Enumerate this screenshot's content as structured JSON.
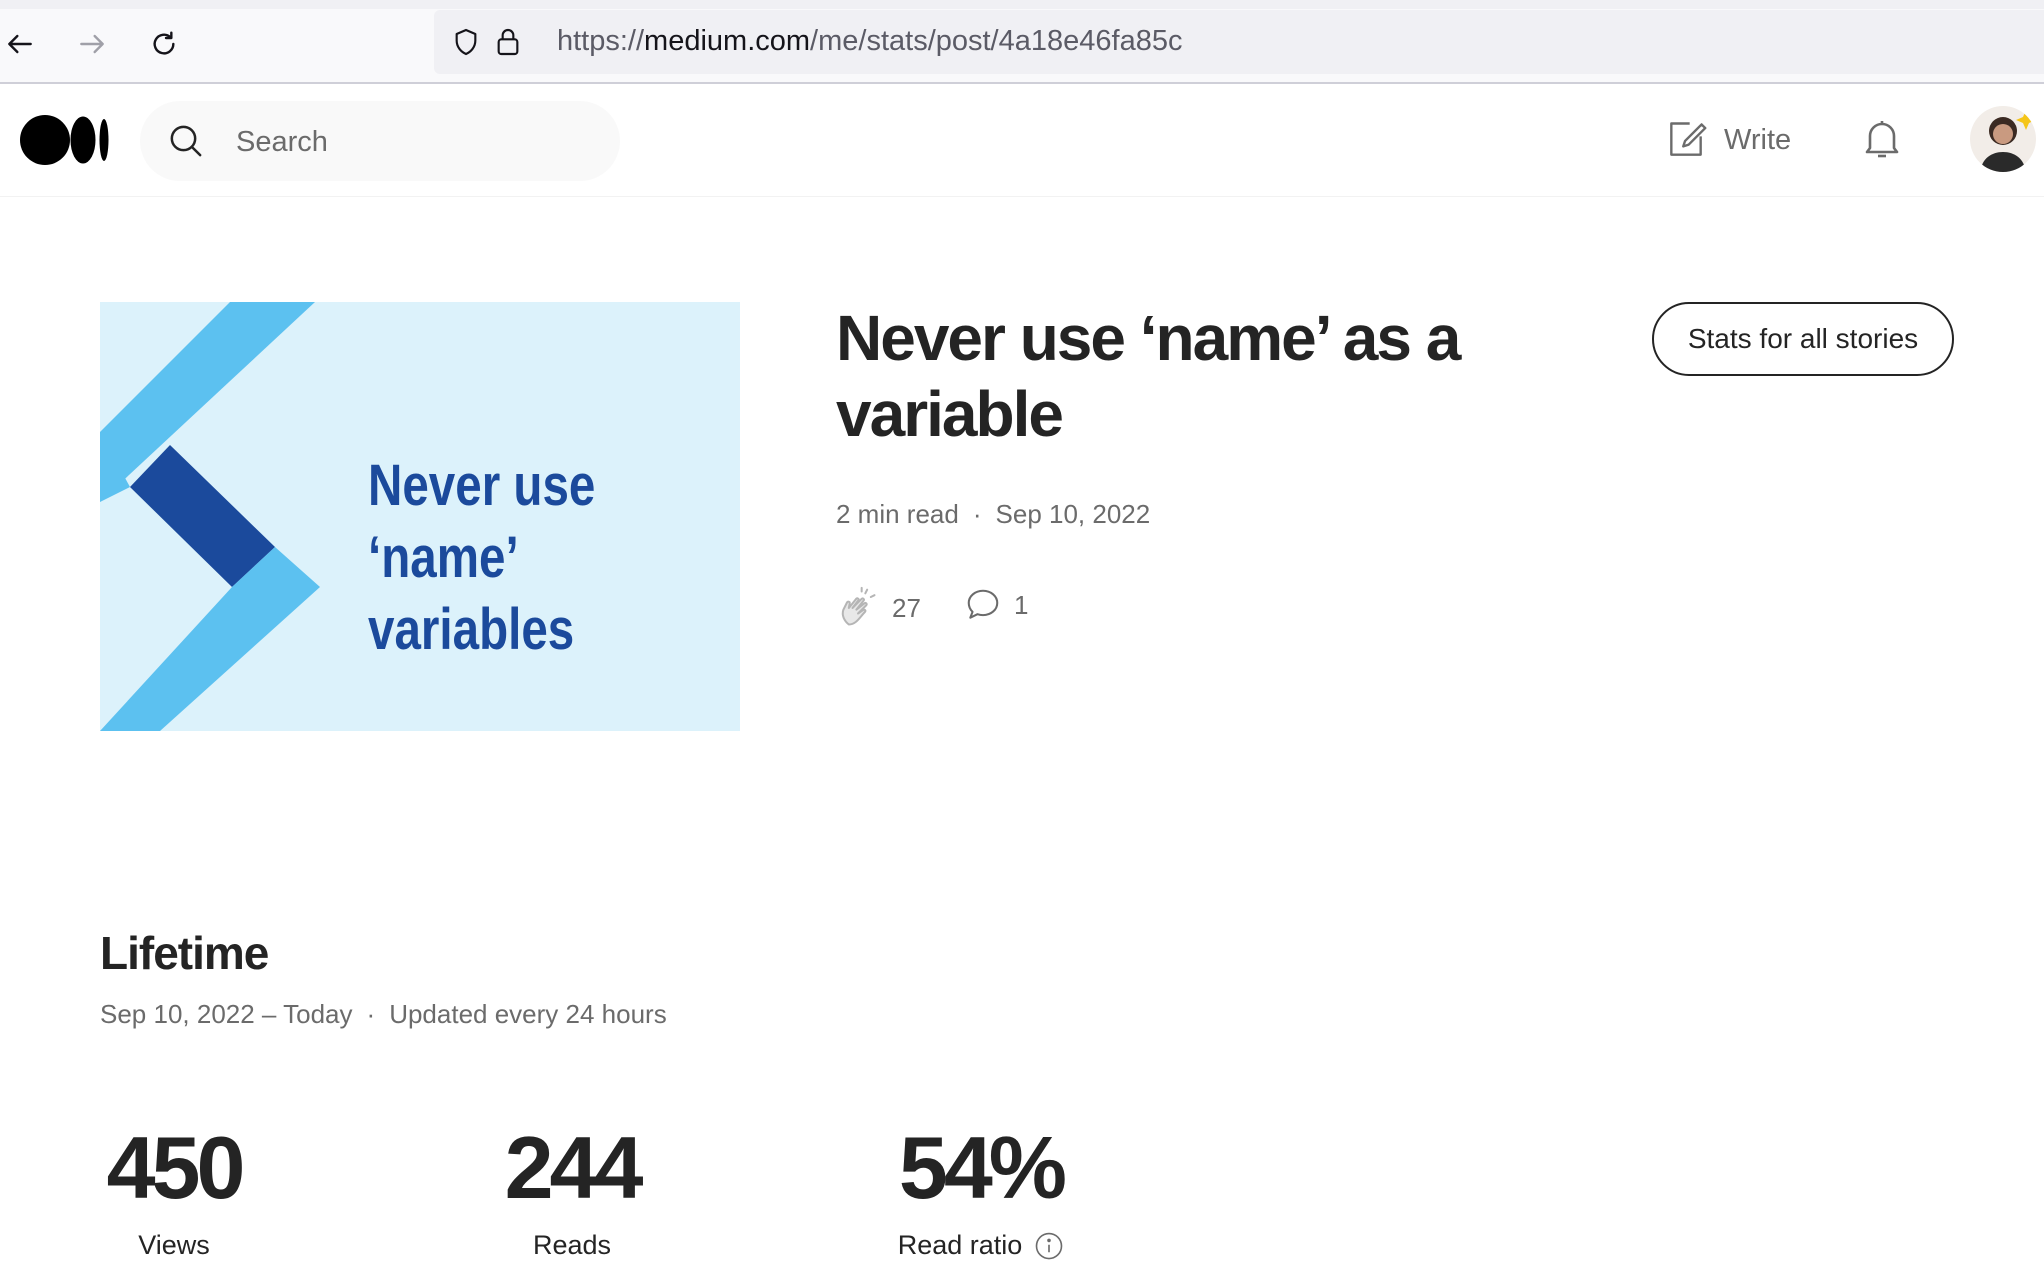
{
  "browser": {
    "url_scheme": "https://",
    "url_domain": "medium.com",
    "url_path": "/me/stats/post/4a18e46fa85c"
  },
  "header": {
    "search_placeholder": "Search",
    "write_label": "Write"
  },
  "story": {
    "thumbnail_lines": [
      "Never use",
      "‘name’",
      "variables"
    ],
    "title": "Never use ‘name’ as a variable",
    "read_time": "2 min read",
    "date": "Sep 10, 2022",
    "claps": "27",
    "responses": "1",
    "stats_all_button": "Stats for all stories"
  },
  "lifetime": {
    "heading": "Lifetime",
    "range": "Sep 10, 2022 – Today",
    "update_note": "Updated every 24 hours",
    "stats": [
      {
        "value": "450",
        "label": "Views"
      },
      {
        "value": "244",
        "label": "Reads"
      },
      {
        "value": "54%",
        "label": "Read ratio"
      }
    ]
  },
  "colors": {
    "accent_dark_blue": "#1b4a9c",
    "accent_light_blue": "#5cc1f0",
    "thumb_bg": "#dcf2fb",
    "text_primary": "#242424",
    "text_secondary": "#6b6b6b"
  }
}
